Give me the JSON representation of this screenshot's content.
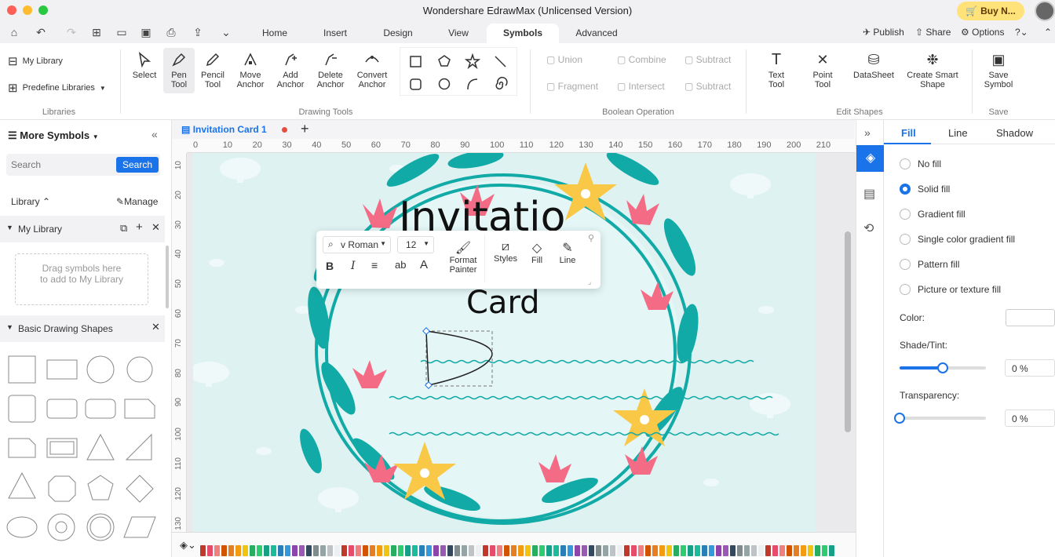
{
  "app": {
    "title": "Wondershare EdrawMax (Unlicensed Version)",
    "buy_label": "Buy N..."
  },
  "menu_tabs": [
    {
      "label": "Home"
    },
    {
      "label": "Insert"
    },
    {
      "label": "Design"
    },
    {
      "label": "View"
    },
    {
      "label": "Symbols"
    },
    {
      "label": "Advanced"
    }
  ],
  "top_right": {
    "publish": "Publish",
    "share": "Share",
    "options": "Options"
  },
  "libraries": {
    "my_library": "My Library",
    "predefine": "Predefine Libraries",
    "group": "Libraries"
  },
  "drawing_tools": {
    "group": "Drawing Tools",
    "tools": [
      {
        "label1": "Select",
        "label2": ""
      },
      {
        "label1": "Pen",
        "label2": "Tool"
      },
      {
        "label1": "Pencil",
        "label2": "Tool"
      },
      {
        "label1": "Move",
        "label2": "Anchor"
      },
      {
        "label1": "Add",
        "label2": "Anchor"
      },
      {
        "label1": "Delete",
        "label2": "Anchor"
      },
      {
        "label1": "Convert",
        "label2": "Anchor"
      }
    ]
  },
  "boolean": {
    "group": "Boolean Operation",
    "items": [
      "Union",
      "Combine",
      "Subtract",
      "Fragment",
      "Intersect",
      "Subtract"
    ]
  },
  "edit_shapes": {
    "group": "Edit Shapes",
    "text_tool1": "Text",
    "text_tool2": "Tool",
    "point_tool1": "Point",
    "point_tool2": "Tool",
    "datasheet": "DataSheet",
    "smart1": "Create Smart",
    "smart2": "Shape"
  },
  "save": {
    "group": "Save",
    "label1": "Save",
    "label2": "Symbol"
  },
  "left_panel": {
    "title": "More Symbols",
    "search_placeholder": "Search",
    "search_button": "Search",
    "library_label": "Library",
    "manage_label": "Manage",
    "my_library": "My Library",
    "drag_hint": "Drag symbols here to add to My Library",
    "basic_shapes": "Basic Drawing Shapes"
  },
  "document": {
    "tab_title": "Invitation Card 1"
  },
  "ruler": {
    "top": [
      "0",
      "10",
      "20",
      "30",
      "40",
      "50",
      "60",
      "70",
      "80",
      "90",
      "100",
      "110",
      "120",
      "130",
      "140",
      "150",
      "160",
      "170",
      "180",
      "190",
      "200",
      "210"
    ],
    "left": [
      "10",
      "20",
      "30",
      "40",
      "50",
      "60",
      "70",
      "80",
      "90",
      "100",
      "110",
      "120",
      "130"
    ]
  },
  "card": {
    "title_line1": "Invitatio",
    "title_line2": "Card"
  },
  "floating_toolbar": {
    "font": "v Roman",
    "size": "12",
    "format_painter1": "Format",
    "format_painter2": "Painter",
    "styles": "Styles",
    "fill": "Fill",
    "line": "Line"
  },
  "right_panel": {
    "tabs": [
      "Fill",
      "Line",
      "Shadow"
    ],
    "fill_options": [
      "No fill",
      "Solid fill",
      "Gradient fill",
      "Single color gradient fill",
      "Pattern fill",
      "Picture or texture fill"
    ],
    "selected_fill": "Solid fill",
    "color_label": "Color:",
    "shade_label": "Shade/Tint:",
    "shade_value": "0 %",
    "shade_level": 0.5,
    "transparency_label": "Transparency:",
    "transparency_value": "0 %",
    "transparency_level": 0
  },
  "colors": {
    "accent": "#1a73e8",
    "teal": "#12aaa6",
    "pink": "#f46b86",
    "yellow": "#f9c846",
    "page_bg": "#dff2f2"
  },
  "palette_colors": [
    "#c0392b",
    "#e84c6b",
    "#f08080",
    "#d35400",
    "#e67e22",
    "#f39c12",
    "#f1c40f",
    "#27ae60",
    "#2ecc71",
    "#16a085",
    "#1abc9c",
    "#2980b9",
    "#3498db",
    "#8e44ad",
    "#9b59b6",
    "#34495e",
    "#7f8c8d",
    "#95a5a6",
    "#bdc3c7",
    "#ecf0f1"
  ]
}
